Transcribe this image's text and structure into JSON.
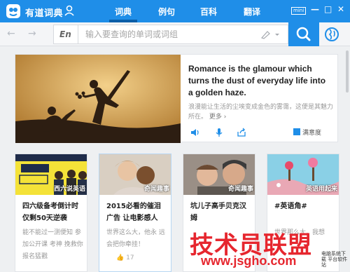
{
  "app": {
    "title": "有道词典",
    "mini_label": "mini"
  },
  "tabs": [
    {
      "label": "词典",
      "active": true
    },
    {
      "label": "例句",
      "active": false
    },
    {
      "label": "百科",
      "active": false
    },
    {
      "label": "翻译",
      "active": false
    }
  ],
  "window_controls": {
    "minimize": "—",
    "maximize": "□",
    "close": "✕"
  },
  "search": {
    "lang": "En",
    "placeholder": "输入要查询的单词或词组"
  },
  "hero": {
    "quote": "Romance is the glamour which turns the dust of everyday life into a golden haze.",
    "translation": "浪漫能让生活的尘埃变成金色的雾霭，这便是其魅力所在。",
    "more_label": "更多 ›",
    "satisfaction_label": "满意度"
  },
  "cards": [
    {
      "category": "西六说英语",
      "title": "四六级备考倒计时 仅剩50天逆袭",
      "desc": "能不能过一测便知 参加公开课 考神 挽救你 报名猛戳",
      "like": ""
    },
    {
      "category": "奇闻趣事",
      "title": "2015必看的催泪 广告 让电影感人",
      "desc": "世界这么大，他永 远会把你牵挂！",
      "like": "17"
    },
    {
      "category": "奇闻趣事",
      "title": "坑儿子高手贝克汉 姆",
      "desc": "",
      "like": ""
    },
    {
      "category": "英语用起来",
      "title": "#英语角#",
      "desc": "世界那么大，我想 ",
      "like": ""
    }
  ],
  "watermark": {
    "main": "技术员联盟",
    "url": "www.jsgho.com",
    "small": "电脑系统下载 平台软件站"
  },
  "colors": {
    "brand": "#1f8ee8",
    "watermark": "#e6262e"
  }
}
